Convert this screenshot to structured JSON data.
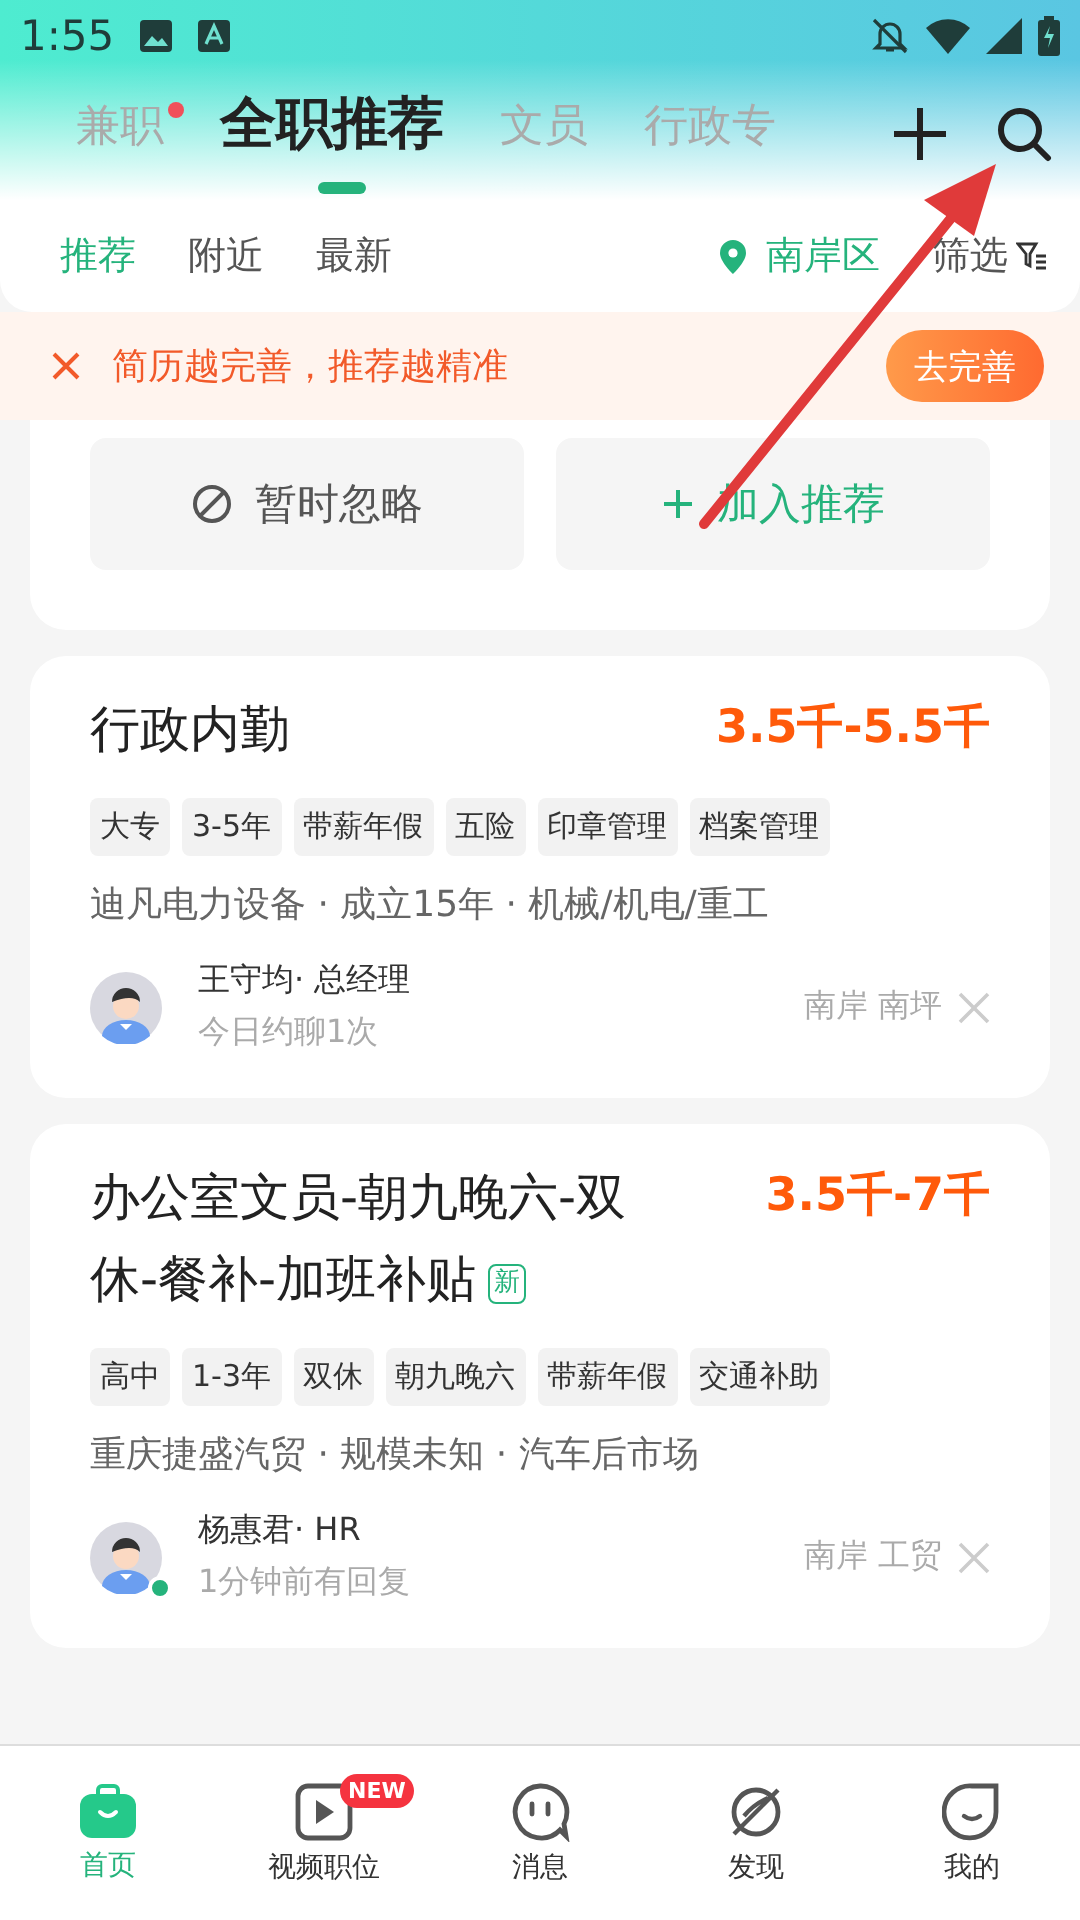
{
  "status_bar": {
    "time": "1:55"
  },
  "top_tabs": [
    {
      "label": "兼职",
      "selected": false,
      "dot": true
    },
    {
      "label": "全职推荐",
      "selected": true,
      "dot": false
    },
    {
      "label": "文员",
      "selected": false,
      "dot": false
    },
    {
      "label": "行政专",
      "selected": false,
      "dot": false
    }
  ],
  "filter_tabs": [
    {
      "label": "推荐",
      "selected": true
    },
    {
      "label": "附近",
      "selected": false
    },
    {
      "label": "最新",
      "selected": false
    }
  ],
  "location": "南岸区",
  "filter_label": "筛选",
  "banner": {
    "text": "简历越完善，推荐越精准",
    "button": "去完善"
  },
  "actions": [
    {
      "kind": "ignore",
      "label": "暂时忽略"
    },
    {
      "kind": "add",
      "label": "加入推荐"
    }
  ],
  "jobs": [
    {
      "title": "行政内勤",
      "is_new": false,
      "salary": "3.5千-5.5千",
      "tags": [
        "大专",
        "3-5年",
        "带薪年假",
        "五险",
        "印章管理",
        "档案管理"
      ],
      "company": "迪凡电力设备 · 成立15年 · 机械/机电/重工",
      "recruiter": "王守均· 总经理",
      "activity": "今日约聊1次",
      "online": false,
      "area": "南岸 南坪"
    },
    {
      "title": "办公室文员-朝九晚六-双休-餐补-加班补贴",
      "is_new": true,
      "new_label": "新",
      "salary": "3.5千-7千",
      "tags": [
        "高中",
        "1-3年",
        "双休",
        "朝九晚六",
        "带薪年假",
        "交通补助"
      ],
      "company": "重庆捷盛汽贸 · 规模未知 · 汽车后市场",
      "recruiter": "杨惠君· HR",
      "activity": "1分钟前有回复",
      "online": true,
      "area": "南岸 工贸"
    }
  ],
  "nav": [
    {
      "kind": "home",
      "label": "首页",
      "selected": true
    },
    {
      "kind": "video",
      "label": "视频职位",
      "selected": false,
      "badge": "NEW"
    },
    {
      "kind": "message",
      "label": "消息",
      "selected": false
    },
    {
      "kind": "discover",
      "label": "发现",
      "selected": false
    },
    {
      "kind": "profile",
      "label": "我的",
      "selected": false
    }
  ]
}
